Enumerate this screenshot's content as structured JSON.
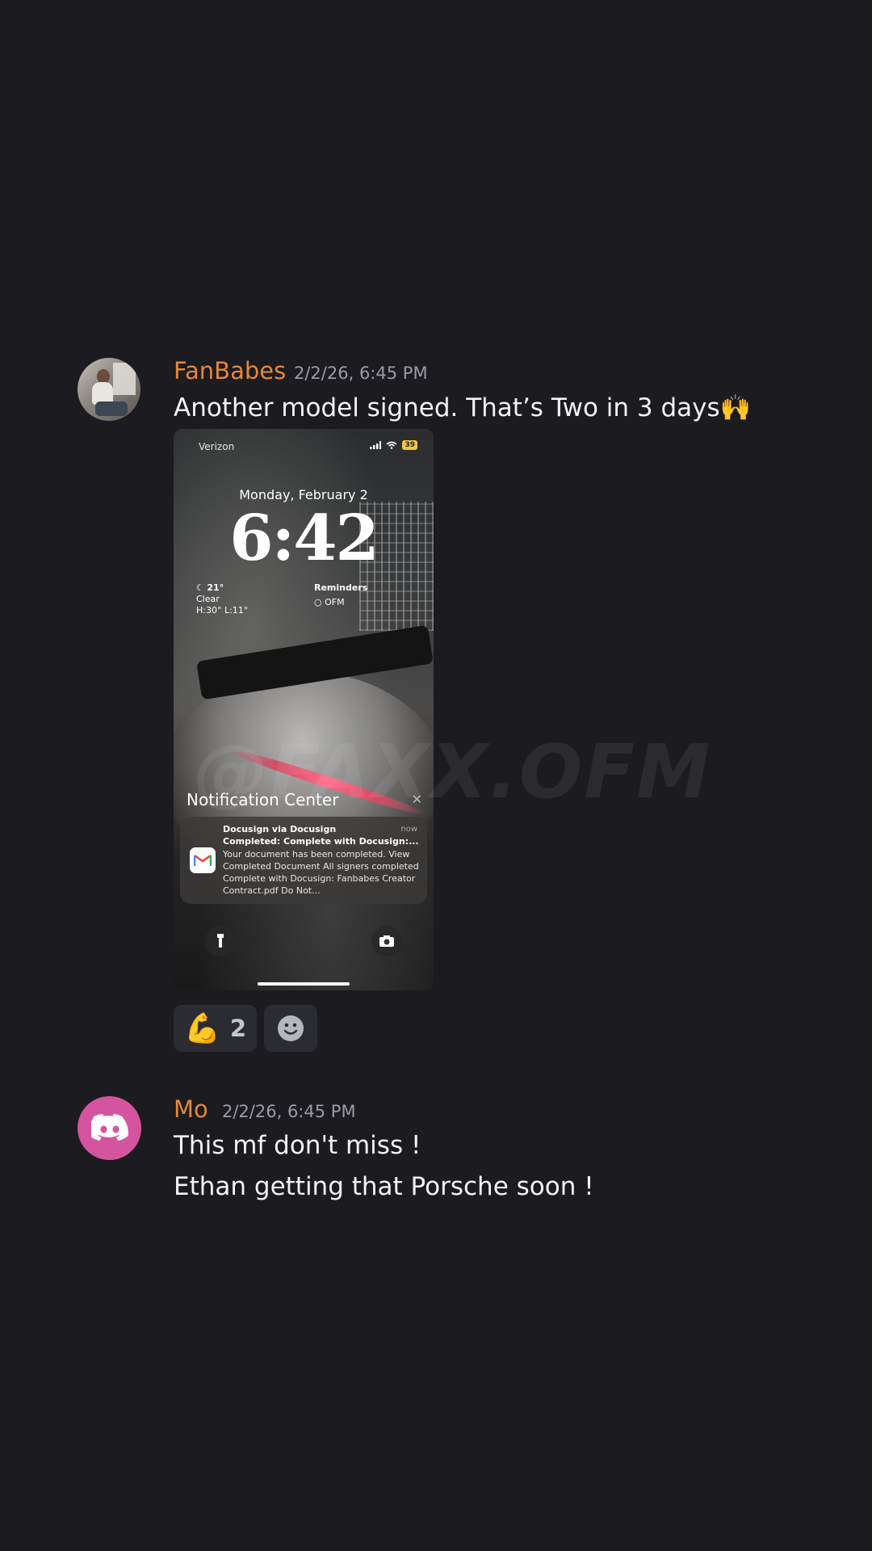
{
  "messages": [
    {
      "username": "FanBabes",
      "timestamp": "2/2/26, 6:45 PM",
      "text": "Another model signed. That’s Two in 3 days🙌",
      "attachment": {
        "carrier": "Verizon",
        "battery": "39",
        "date": "Monday, February 2",
        "time": "6:42",
        "weather": {
          "temp": "21°",
          "condition": "Clear",
          "range": "H:30° L:11°"
        },
        "reminders": {
          "title": "Reminders",
          "item": "OFM"
        },
        "notification_center": "Notification Center",
        "notification": {
          "app": "Docusign via Docusign",
          "time": "now",
          "subject": "Completed: Complete with Docusign:...",
          "body": "Your document has been completed. View Completed Document All signers completed Complete with Docusign: Fanbabes Creator Contract.pdf Do Not..."
        }
      },
      "reactions": [
        {
          "emoji": "💪",
          "count": "2"
        },
        {
          "icon": "add-reaction-icon"
        }
      ]
    },
    {
      "username": "Mo",
      "timestamp": "2/2/26, 6:45 PM",
      "lines": [
        "This mf don't miss !",
        "Ethan getting that Porsche soon !"
      ]
    }
  ],
  "watermark": "@FAXX.OFM",
  "colors": {
    "background": "#1b1b20",
    "username": "#e4883a",
    "timestamp": "#9a9ca3",
    "discord_avatar": "#d4549f"
  }
}
